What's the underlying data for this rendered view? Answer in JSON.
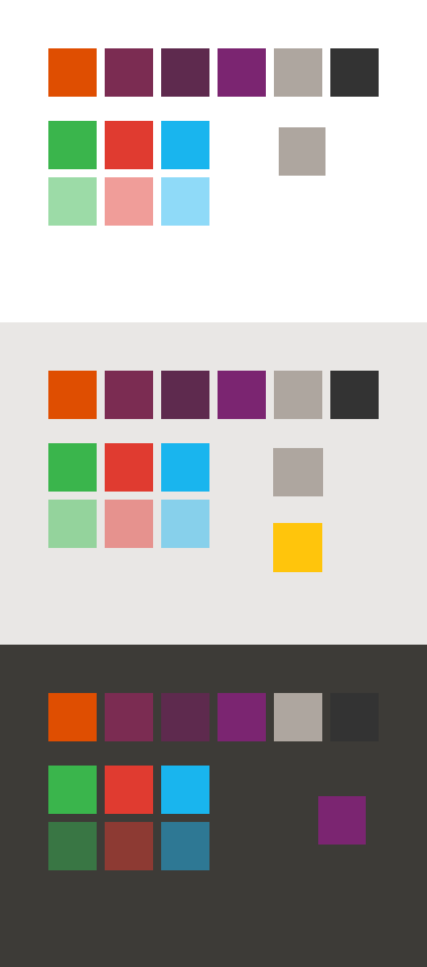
{
  "sections": [
    {
      "background": "#ffffff",
      "primary": [
        "#df4e01",
        "#7b2c52",
        "#5e2a4e",
        "#7b2571",
        "#aea69f",
        "#333333"
      ],
      "strong": [
        "#3ab54c",
        "#e03b30",
        "#19b5ee"
      ],
      "light": [
        "#9cdba7",
        "#f09d99",
        "#8fdaf8"
      ],
      "extras": [
        "#aea69f"
      ]
    },
    {
      "background": "#e9e7e5",
      "primary": [
        "#df4e01",
        "#7b2c52",
        "#5e2a4e",
        "#7b2571",
        "#aea69f",
        "#333333"
      ],
      "strong": [
        "#3ab54c",
        "#e03b30",
        "#19b5ee"
      ],
      "light": [
        "#94d39c",
        "#e6928e",
        "#87d0eb"
      ],
      "extras": [
        "#aea69f",
        "#ffc50c"
      ]
    },
    {
      "background": "#3d3b37",
      "primary": [
        "#df4e01",
        "#7b2c52",
        "#5e2a4e",
        "#7b2571",
        "#aea69f",
        "#333333"
      ],
      "strong": [
        "#3ab54c",
        "#e03b30",
        "#19b5ee"
      ],
      "light": [
        "#397644",
        "#8d3a33",
        "#2e7894"
      ],
      "extras": [
        "#7b2571"
      ]
    }
  ]
}
